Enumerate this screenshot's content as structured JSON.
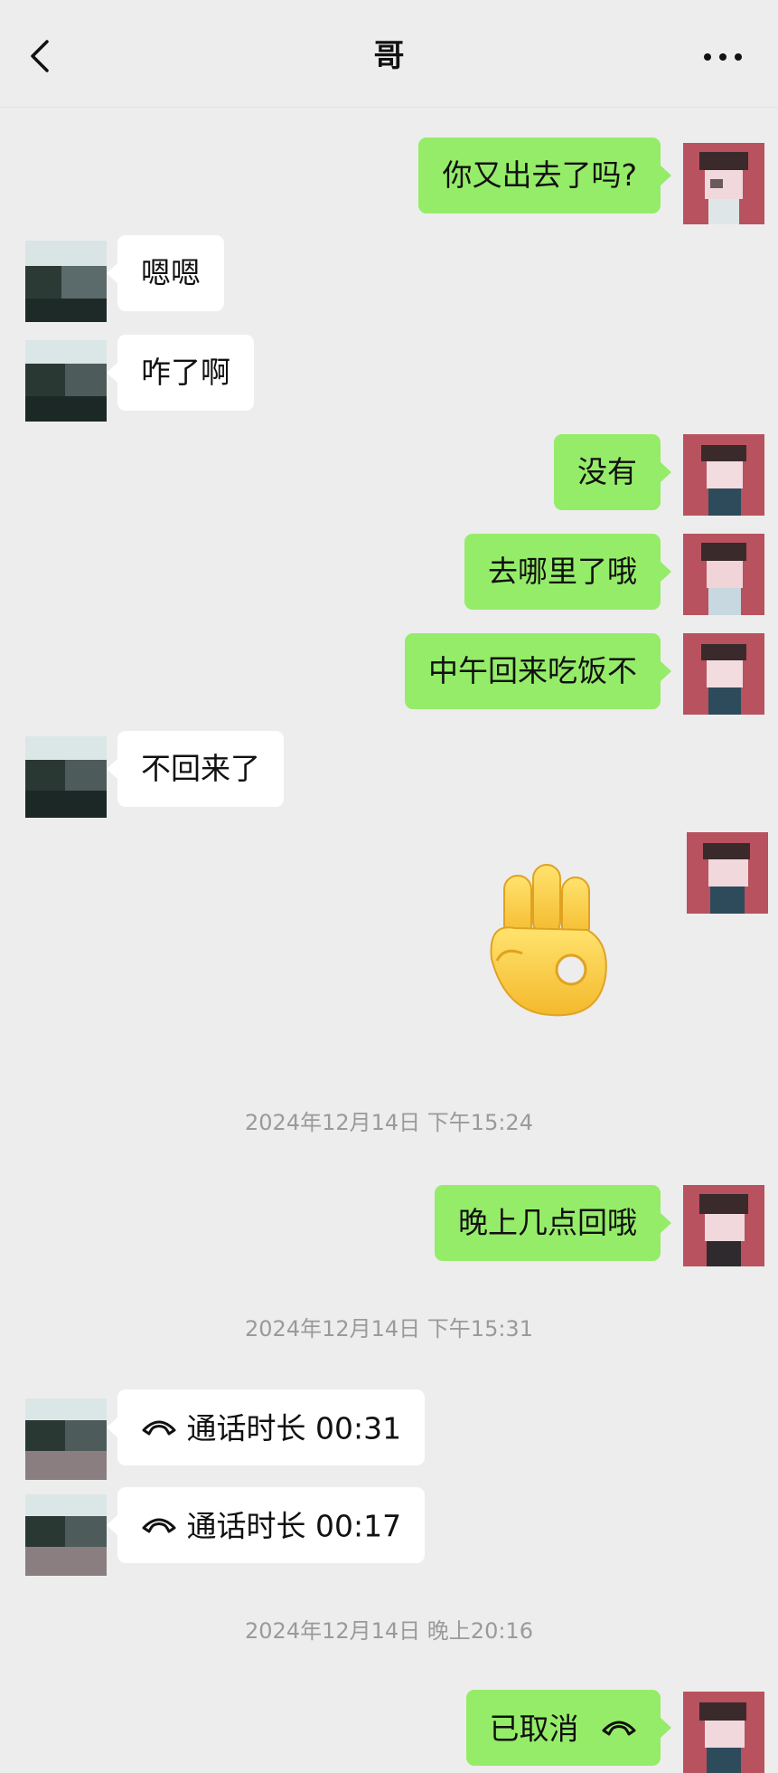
{
  "header": {
    "title": "哥"
  },
  "messages": [
    {
      "id": "m1",
      "side": "out",
      "text": "你又出去了吗?"
    },
    {
      "id": "m2",
      "side": "in",
      "text": "嗯嗯"
    },
    {
      "id": "m3",
      "side": "in",
      "text": "咋了啊"
    },
    {
      "id": "m4",
      "side": "out",
      "text": "没有"
    },
    {
      "id": "m5",
      "side": "out",
      "text": "去哪里了哦"
    },
    {
      "id": "m6",
      "side": "out",
      "text": "中午回来吃饭不"
    },
    {
      "id": "m7",
      "side": "in",
      "text": "不回来了"
    },
    {
      "id": "m8",
      "side": "out",
      "sticker": "ok-hand-emoji"
    },
    {
      "id": "m9",
      "side": "out",
      "text": "晚上几点回哦"
    },
    {
      "id": "m10",
      "side": "in",
      "call": "通话时长 00:31"
    },
    {
      "id": "m11",
      "side": "in",
      "call": "通话时长 00:17"
    },
    {
      "id": "m12",
      "side": "out",
      "call": "已取消"
    }
  ],
  "timestamps": [
    "2024年12月14日 下午15:24",
    "2024年12月14日 下午15:31",
    "2024年12月14日 晚上20:16"
  ],
  "icons": {
    "back": "back-icon",
    "more": "more-icon",
    "call": "phone-icon",
    "sticker": "ok-hand-emoji"
  },
  "colors": {
    "background": "#ededed",
    "outgoing_bubble": "#95ec69",
    "incoming_bubble": "#ffffff",
    "timestamp": "#9a9a9a"
  }
}
